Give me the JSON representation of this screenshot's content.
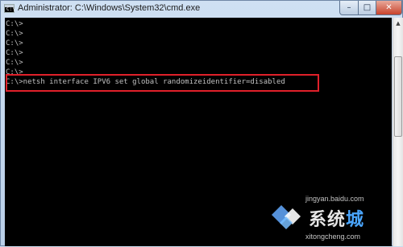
{
  "window": {
    "title": "Administrator: C:\\Windows\\System32\\cmd.exe",
    "icon": "cmd-icon",
    "icon_prompt": "C:\\",
    "buttons": {
      "minimize": "–",
      "maximize": "□",
      "close": "✕"
    }
  },
  "console": {
    "lines": [
      "C:\\>",
      "C:\\>",
      "C:\\>",
      "C:\\>",
      "C:\\>",
      "C:\\>"
    ],
    "command": "C:\\>netsh interface IPV6 set global randomizeidentifier=disabled",
    "text_color": "#c0c0c0",
    "background": "#000000",
    "highlight_color": "#e0202a"
  },
  "scrollbar": {
    "up_arrow": "▲"
  },
  "watermark": {
    "brand_prefix": "系统",
    "brand_accent": "城",
    "top_text": "jingyan.baidu.com",
    "site": "xitongcheng.com"
  }
}
